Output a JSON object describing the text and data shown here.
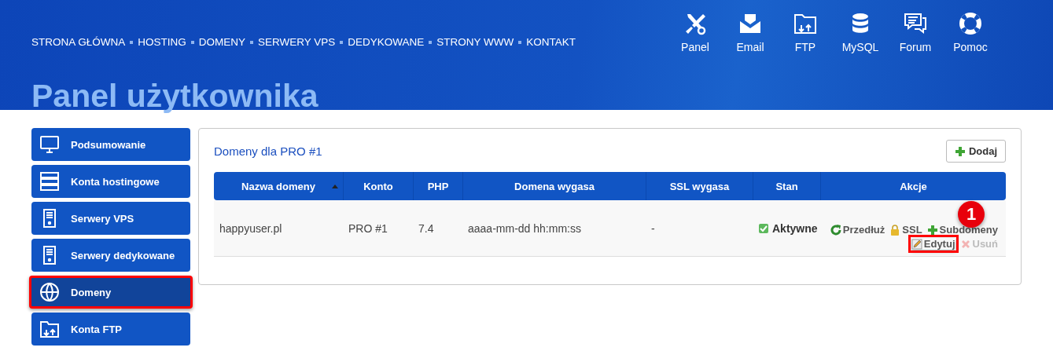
{
  "nav": {
    "links": [
      "STRONA GŁÓWNA",
      "HOSTING",
      "DOMENY",
      "SERWERY VPS",
      "DEDYKOWANE",
      "STRONY WWW",
      "KONTAKT"
    ],
    "tools": [
      {
        "kind": "tools",
        "label": "Panel"
      },
      {
        "kind": "email",
        "label": "Email"
      },
      {
        "kind": "folder",
        "label": "FTP"
      },
      {
        "kind": "database",
        "label": "MySQL"
      },
      {
        "kind": "chat",
        "label": "Forum"
      },
      {
        "kind": "lifebuoy",
        "label": "Pomoc"
      }
    ]
  },
  "page_title": "Panel użytkownika",
  "sidebar": {
    "items": [
      {
        "kind": "monitor",
        "label": "Podsumowanie",
        "selected": false,
        "highlighted": false
      },
      {
        "kind": "servers",
        "label": "Konta hostingowe",
        "selected": false,
        "highlighted": false
      },
      {
        "kind": "tower",
        "label": "Serwery VPS",
        "selected": false,
        "highlighted": false
      },
      {
        "kind": "tower",
        "label": "Serwery dedykowane",
        "selected": false,
        "highlighted": false
      },
      {
        "kind": "globe",
        "label": "Domeny",
        "selected": true,
        "highlighted": true
      },
      {
        "kind": "folder",
        "label": "Konta FTP",
        "selected": false,
        "highlighted": false
      }
    ]
  },
  "panel": {
    "title": "Domeny dla PRO #1",
    "add_button": "Dodaj",
    "table": {
      "columns": [
        {
          "label": "Nazwa domeny",
          "sorted": true
        },
        {
          "label": "Konto",
          "sorted": false
        },
        {
          "label": "PHP",
          "sorted": false
        },
        {
          "label": "Domena wygasa",
          "sorted": false
        },
        {
          "label": "SSL wygasa",
          "sorted": false
        },
        {
          "label": "Stan",
          "sorted": false
        },
        {
          "label": "Akcje",
          "sorted": false
        }
      ],
      "rows": [
        {
          "domain": "happyuser.pl",
          "account": "PRO #1",
          "php": "7.4",
          "expires": "aaaa-mm-dd hh:mm:ss",
          "ssl_expires": "-",
          "status": "Aktywne",
          "actions": [
            {
              "kind": "renew",
              "label": "Przedłuż",
              "disabled": false,
              "highlighted": false
            },
            {
              "kind": "ssl",
              "label": "SSL",
              "disabled": false,
              "highlighted": false
            },
            {
              "kind": "add",
              "label": "Subdomeny",
              "disabled": false,
              "highlighted": false
            },
            {
              "kind": "edit",
              "label": "Edytuj",
              "disabled": false,
              "highlighted": true
            },
            {
              "kind": "delete",
              "label": "Usuń",
              "disabled": true,
              "highlighted": false
            }
          ]
        }
      ]
    }
  },
  "callout": {
    "number": "1"
  }
}
